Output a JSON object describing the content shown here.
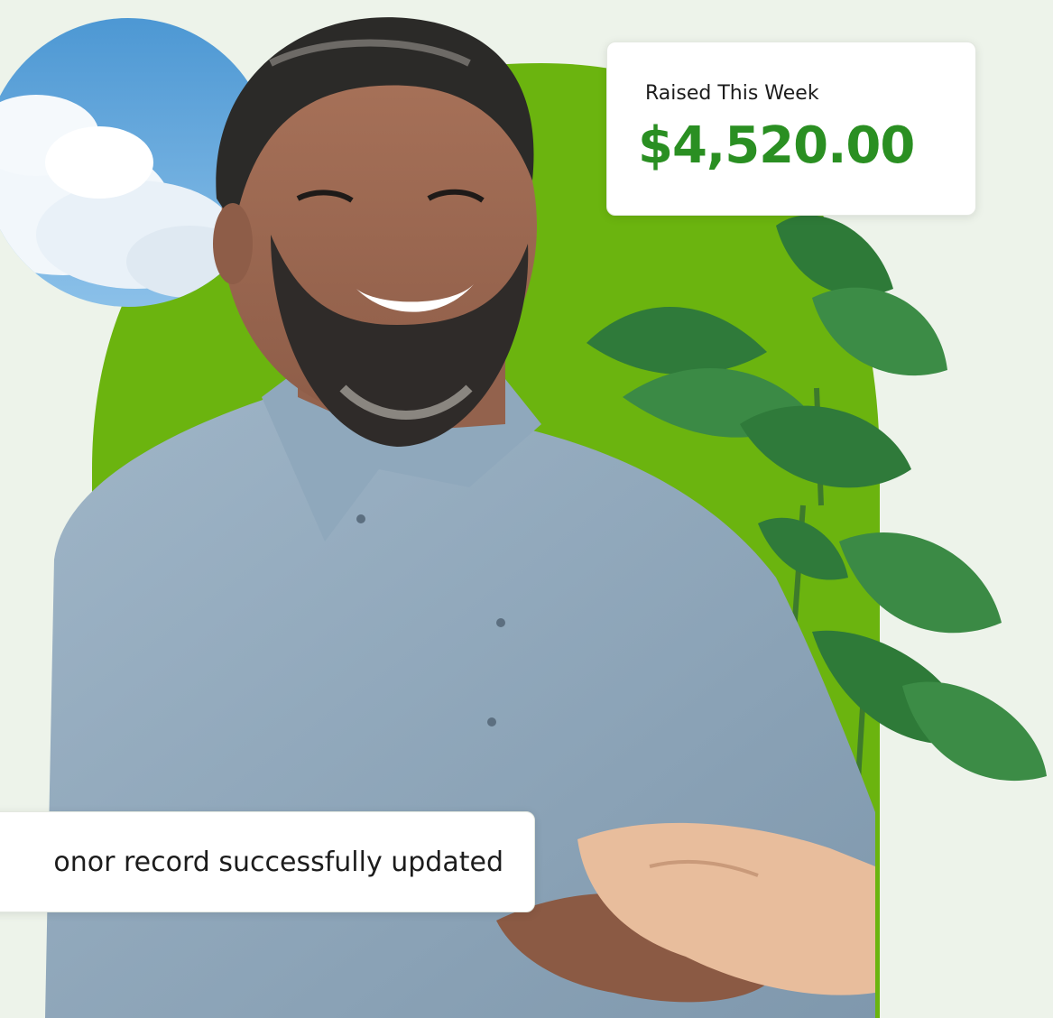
{
  "colors": {
    "background": "#edf3ea",
    "brand_green": "#6bb40f",
    "accent_text": "#2a8f22",
    "card_bg": "#ffffff"
  },
  "raised_card": {
    "label": "Raised This Week",
    "amount": "$4,520.00"
  },
  "toast": {
    "message": "onor record successfully updated"
  },
  "images": {
    "sky": "sky-clouds-circle",
    "person": "smiling-bearded-man-shaking-hands",
    "plant": "monstera-plant"
  }
}
